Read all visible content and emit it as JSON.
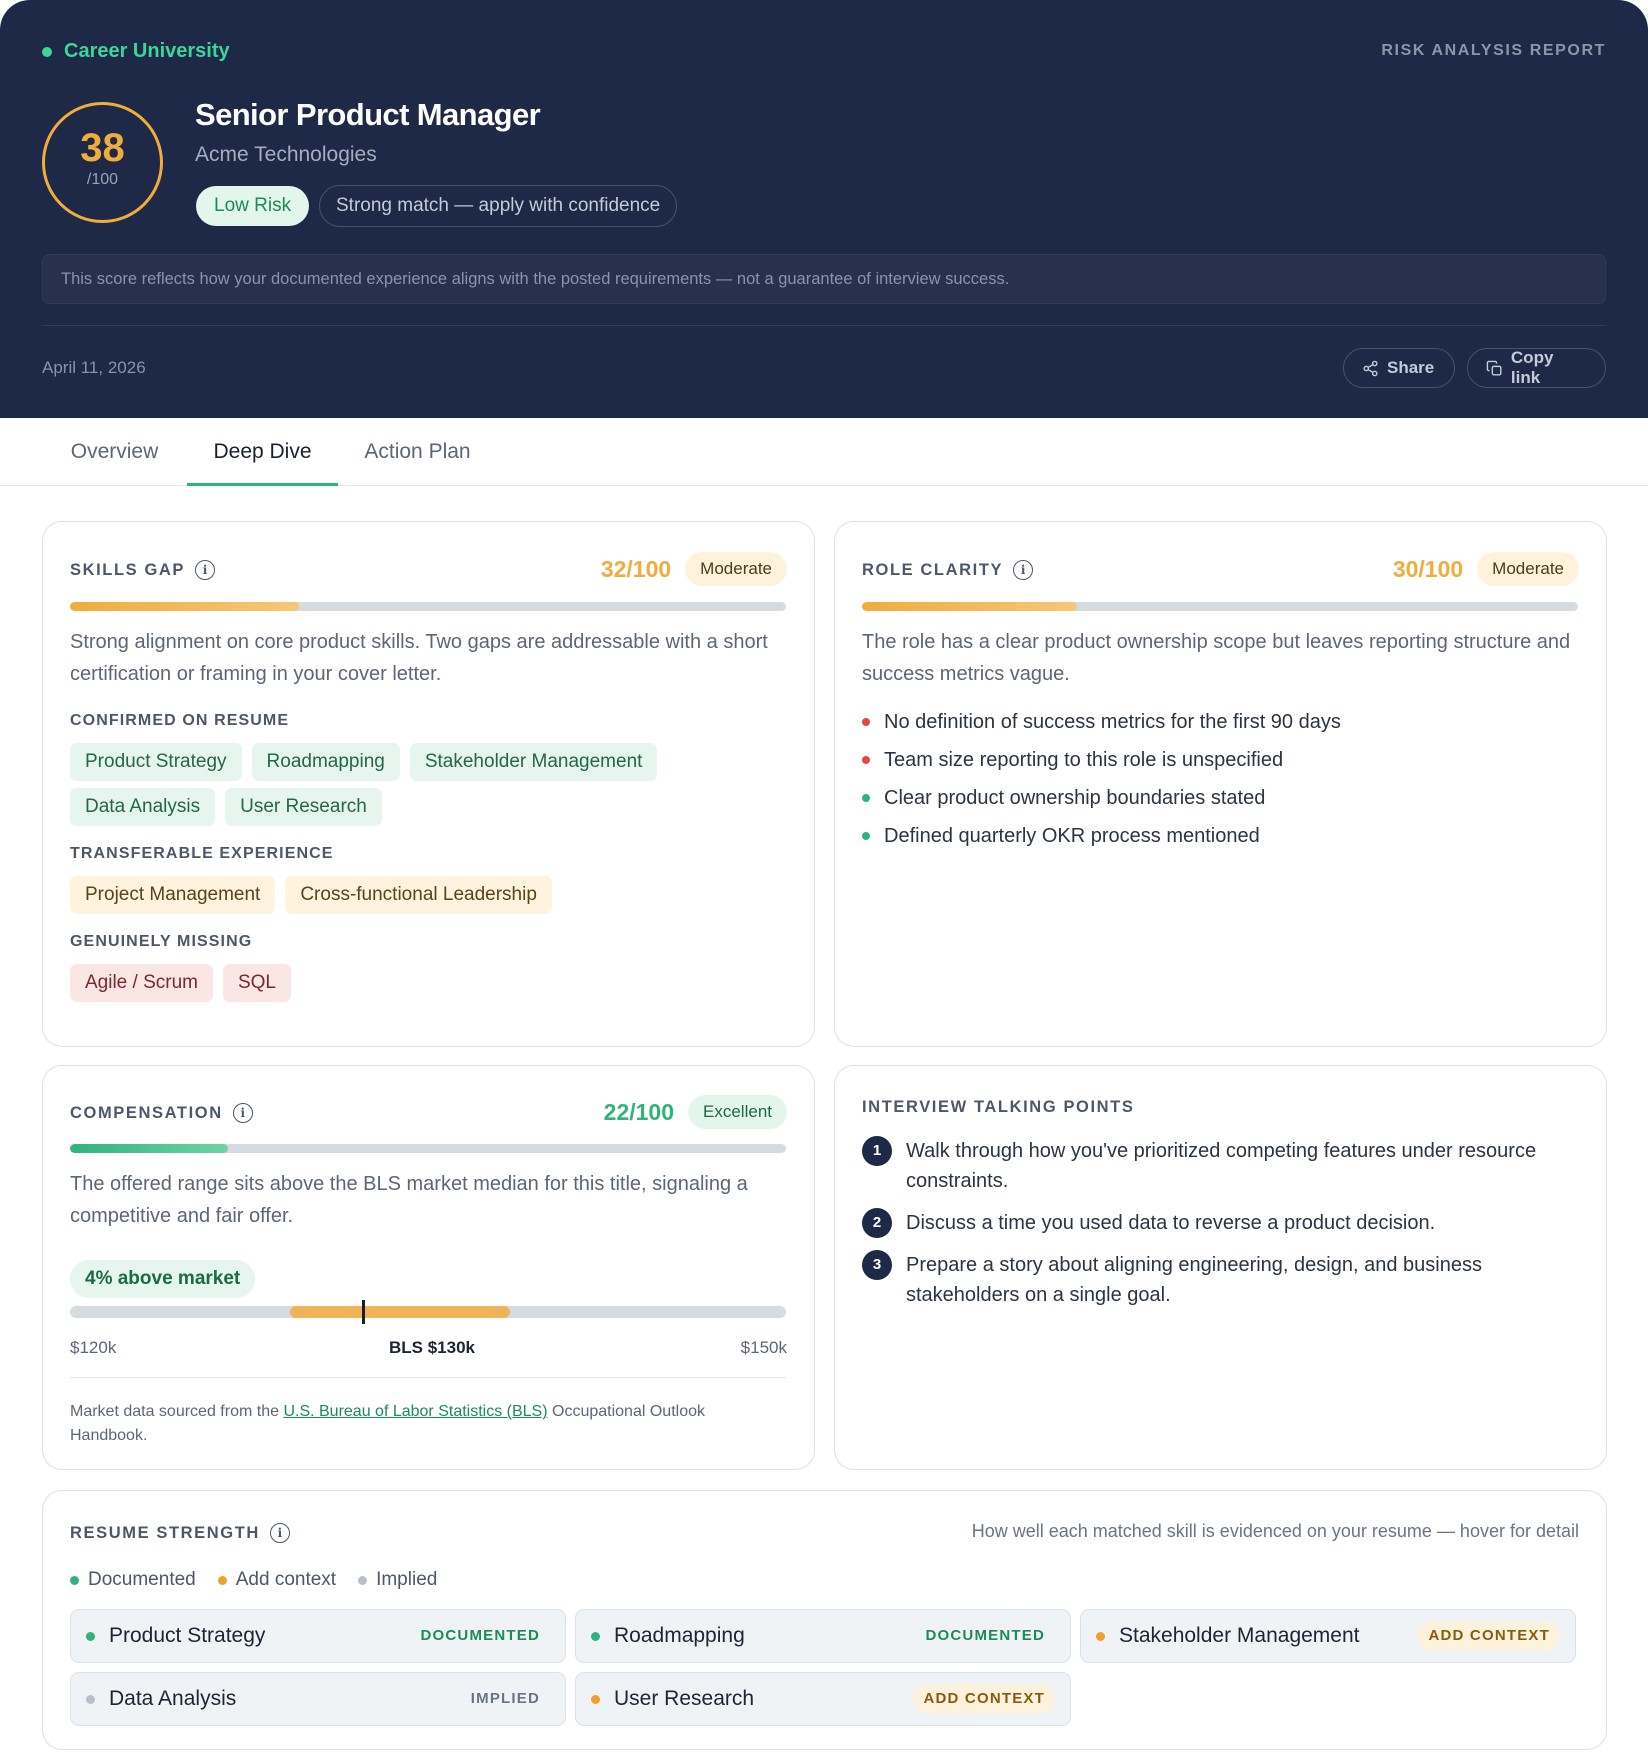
{
  "header": {
    "brand": "Career University",
    "report_label": "RISK ANALYSIS REPORT",
    "score": "38",
    "score_max": "/100",
    "job_title": "Senior Product Manager",
    "company": "Acme Technologies",
    "risk_pill": "Low Risk",
    "match_pill": "Strong match — apply with confidence",
    "disclaimer": "This score reflects how your documented experience aligns with the posted requirements — not a guarantee of interview success.",
    "date": "April 11, 2026",
    "share_label": "Share",
    "copy_label": "Copy link"
  },
  "tabs": [
    {
      "label": "Overview",
      "active": false
    },
    {
      "label": "Deep Dive",
      "active": true
    },
    {
      "label": "Action Plan",
      "active": false
    }
  ],
  "skills_gap": {
    "label": "SKILLS GAP",
    "score": "32/100",
    "score_fraction": 0.32,
    "badge": "Moderate",
    "description": "Strong alignment on core product skills. Two gaps are addressable with a short certification or framing in your cover letter.",
    "confirmed_label": "CONFIRMED ON RESUME",
    "confirmed": [
      "Product Strategy",
      "Roadmapping",
      "Stakeholder Management",
      "Data Analysis",
      "User Research"
    ],
    "transferable_label": "TRANSFERABLE EXPERIENCE",
    "transferable": [
      "Project Management",
      "Cross-functional Leadership"
    ],
    "missing_label": "GENUINELY MISSING",
    "missing": [
      "Agile / Scrum",
      "SQL"
    ]
  },
  "role_clarity": {
    "label": "ROLE CLARITY",
    "score": "30/100",
    "score_fraction": 0.3,
    "badge": "Moderate",
    "description": "The role has a clear product ownership scope but leaves reporting structure and success metrics vague.",
    "items": [
      {
        "text": "No definition of success metrics for the first 90 days",
        "status": "negative"
      },
      {
        "text": "Team size reporting to this role is unspecified",
        "status": "negative"
      },
      {
        "text": "Clear product ownership boundaries stated",
        "status": "positive"
      },
      {
        "text": "Defined quarterly OKR process mentioned",
        "status": "positive"
      }
    ]
  },
  "compensation": {
    "label": "COMPENSATION",
    "score": "22/100",
    "score_fraction": 0.22,
    "badge": "Excellent",
    "description": "The offered range sits above the BLS market median for this title, signaling a competitive and fair offer.",
    "market_pill": "4% above market",
    "range_min_label": "$120k",
    "range_mid_label": "BLS $130k",
    "range_max_label": "$150k",
    "source_prefix": "Market data sourced from the ",
    "source_link": "U.S. Bureau of Labor Statistics (BLS)",
    "source_suffix": " Occupational Outlook Handbook."
  },
  "talking_points": {
    "label": "INTERVIEW TALKING POINTS",
    "items": [
      {
        "num": "1",
        "text": "Walk through how you've prioritized competing features under resource constraints."
      },
      {
        "num": "2",
        "text": "Discuss a time you used data to reverse a product decision."
      },
      {
        "num": "3",
        "text": "Prepare a story about aligning engineering, design, and business stakeholders on a single goal."
      }
    ]
  },
  "resume_strength": {
    "label": "RESUME STRENGTH",
    "hint": "How well each matched skill is evidenced on your resume — hover for detail",
    "legend": [
      {
        "label": "Documented",
        "color": "#2fb37e"
      },
      {
        "label": "Add context",
        "color": "#f0a030"
      },
      {
        "label": "Implied",
        "color": "#b8bfcb"
      }
    ],
    "skills": [
      {
        "name": "Product Strategy",
        "status": "DOCUMENTED",
        "kind": "doc"
      },
      {
        "name": "Roadmapping",
        "status": "DOCUMENTED",
        "kind": "doc"
      },
      {
        "name": "Stakeholder Management",
        "status": "ADD CONTEXT",
        "kind": "add"
      },
      {
        "name": "Data Analysis",
        "status": "IMPLIED",
        "kind": "imp"
      },
      {
        "name": "User Research",
        "status": "ADD CONTEXT",
        "kind": "add"
      }
    ]
  },
  "colors": {
    "header_bg": "#1e2847",
    "accent_green": "#2fb37e",
    "accent_amber": "#f0ad3c",
    "negative_red": "#e04848"
  }
}
